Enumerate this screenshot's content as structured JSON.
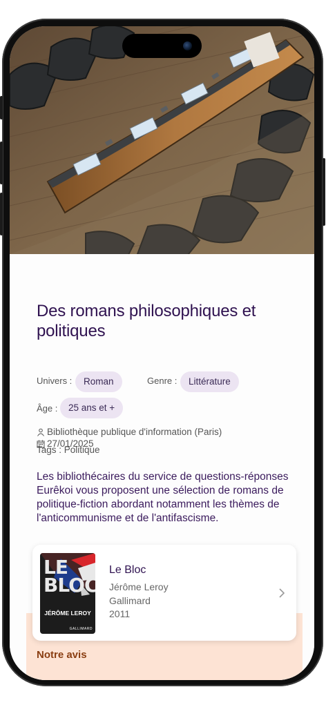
{
  "title": "Des romans philosophiques et politiques",
  "univers": {
    "label": "Univers :",
    "value": "Roman"
  },
  "genre": {
    "label": "Genre :",
    "value": "Littérature"
  },
  "age": {
    "label": "Âge :",
    "value": "25 ans et +"
  },
  "library": "Bibliothèque publique d'information (Paris)",
  "date": "27/01/2025",
  "tags": "Tags : Politique",
  "description": "Les bibliothécaires du service de questions-réponses Eurêkoi vous proposent une sélection de romans de politique-fiction abordant notamment les thèmes de l'anticommunisme et de l'antifascisme.",
  "book": {
    "title": "Le Bloc",
    "author": "Jérôme Leroy",
    "publisher": "Gallimard",
    "year": "2011",
    "cover_title": "LE BLOC",
    "cover_author": "JÉRÔME LEROY",
    "cover_publisher": "GALLIMARD"
  },
  "avis_heading": "Notre avis",
  "icons": {
    "library": "person-icon",
    "date": "calendar-icon",
    "card": "chevron-right-icon"
  },
  "colors": {
    "title": "#2f1250",
    "chip_bg": "#ece4f2",
    "avis_bg": "#fde3d4",
    "avis_text": "#8a3e12"
  }
}
